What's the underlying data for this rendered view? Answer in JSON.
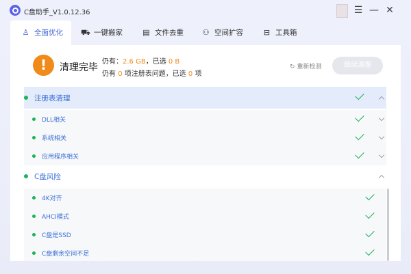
{
  "app": {
    "title": "C盘助手_V1.0.12.36"
  },
  "tabs": [
    {
      "label": "全面优化",
      "icon": "broom-icon"
    },
    {
      "label": "一键搬家",
      "icon": "truck-icon"
    },
    {
      "label": "文件去重",
      "icon": "file-icon"
    },
    {
      "label": "空间扩容",
      "icon": "expand-icon"
    },
    {
      "label": "工具箱",
      "icon": "toolbox-icon"
    }
  ],
  "summary": {
    "status": "清理完毕",
    "line1": {
      "prefix": "仍有：",
      "size": "2.6 GB",
      "mid": "，已选 ",
      "selected": "0 B"
    },
    "line2": {
      "prefix": "仍有 ",
      "issues": "0",
      "mid": " 项注册表问题，已选 ",
      "selected": "0",
      "suffix": " 项"
    },
    "rescan_label": "重新检测",
    "continue_label": "继续清理"
  },
  "groups": [
    {
      "label": "注册表清理",
      "expanded": true,
      "items": [
        "DLL相关",
        "系统相关",
        "应用程序相关"
      ]
    },
    {
      "label": "C盘风险",
      "expanded": true,
      "items": [
        "4K对齐",
        "AHCI模式",
        "C盘是SSD",
        "C盘剩余空间不足"
      ]
    }
  ],
  "colors": {
    "accent": "#3a6fd8",
    "success": "#1ab25b",
    "warning": "#f08a1a"
  }
}
